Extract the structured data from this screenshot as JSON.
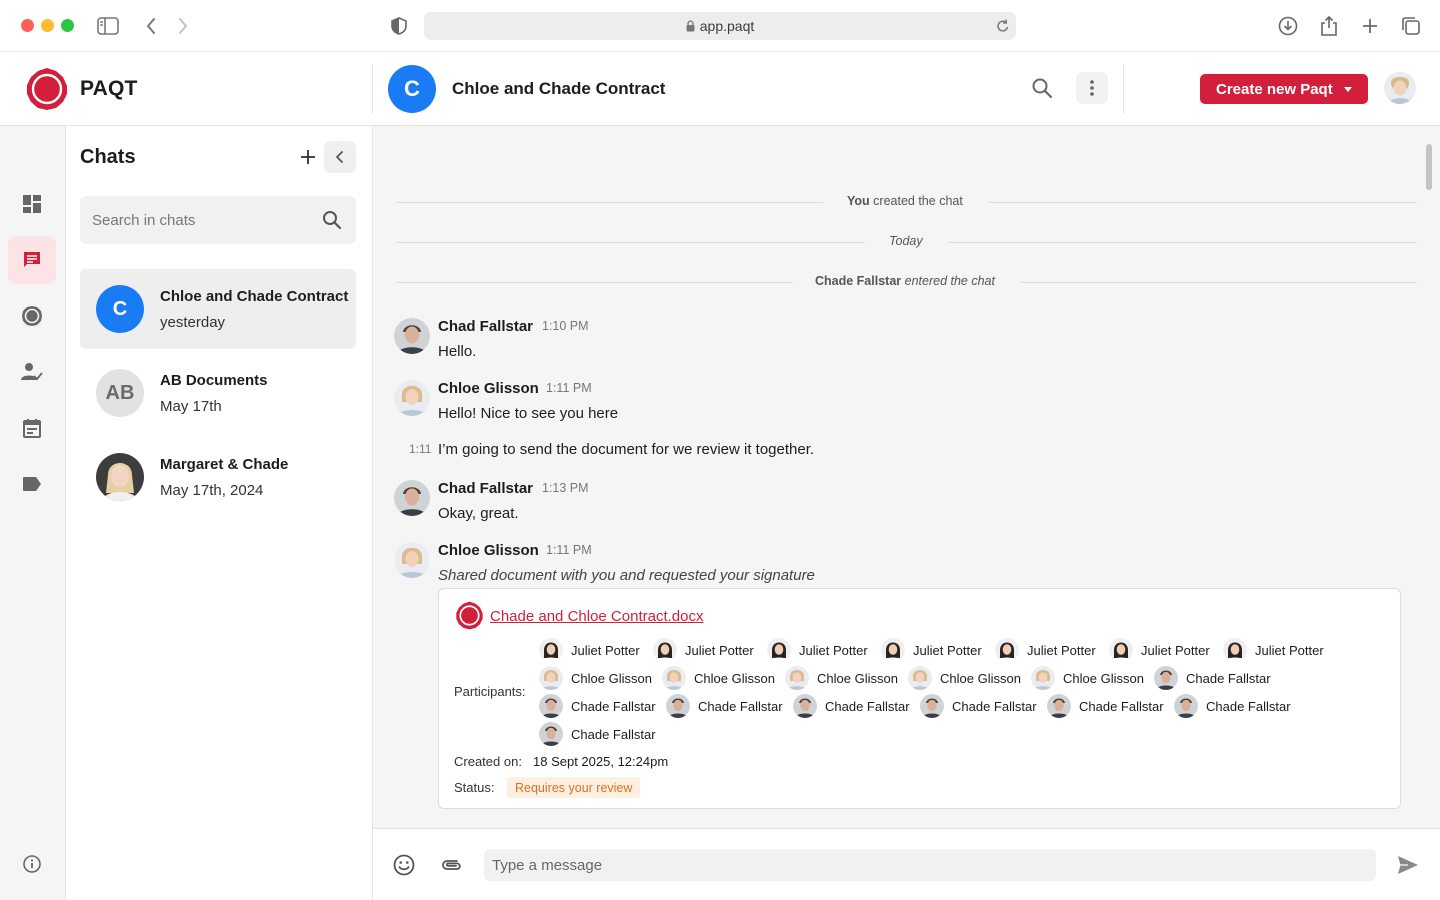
{
  "browser": {
    "url": "app.paqt"
  },
  "header": {
    "brand": "PAQT",
    "chat_avatar_letter": "C",
    "chat_title": "Chloe and Chade Contract",
    "create_button": "Create new Paqt"
  },
  "sidebar": {
    "title": "Chats",
    "search_placeholder": "Search in chats",
    "chats": [
      {
        "avatar": "C",
        "name": "Chloe and Chade Contract",
        "date": "yesterday"
      },
      {
        "avatar": "AB",
        "name": "AB Documents",
        "date": "May 17th"
      },
      {
        "avatar": "",
        "name": "Margaret & Chade",
        "date": "May 17th, 2024"
      }
    ]
  },
  "conversation": {
    "system1_bold": "You",
    "system1_rest": "created the chat",
    "day_divider": "Today",
    "system2_bold": "Chade Fallstar",
    "system2_rest": "entered the chat",
    "messages": [
      {
        "author": "Chad Fallstar",
        "time": "1:10 PM",
        "text": "Hello."
      },
      {
        "author": "Chloe Glisson",
        "time": "1:11 PM",
        "text": "Hello! Nice to see you here"
      },
      {
        "side_time": "1:11",
        "text": "I’m going to send the document for we review it together."
      },
      {
        "author": "Chad Fallstar",
        "time": "1:13 PM",
        "text": "Okay, great."
      },
      {
        "author": "Chloe Glisson",
        "time": "1:11 PM",
        "text": "Shared document with you and requested your signature"
      }
    ],
    "document": {
      "filename": "Chade and Chloe Contract.docx",
      "participants_label": "Participants:",
      "participants_row1": [
        "Juliet Potter",
        "Juliet Potter",
        "Juliet Potter",
        "Juliet Potter",
        "Juliet Potter",
        "Juliet Potter",
        "Juliet Potter"
      ],
      "participants_row2": [
        "Chloe Glisson",
        "Chloe Glisson",
        "Chloe Glisson",
        "Chloe Glisson",
        "Chloe Glisson",
        "Chade Fallstar"
      ],
      "participants_row3": [
        "Chade Fallstar",
        "Chade Fallstar",
        "Chade Fallstar",
        "Chade Fallstar",
        "Chade Fallstar",
        "Chade Fallstar"
      ],
      "participants_row4": [
        "Chade Fallstar"
      ],
      "created_label": "Created on:",
      "created_value": "18 Sept 2025, 12:24pm",
      "status_label": "Status:",
      "status_value": "Requires your review"
    }
  },
  "composer": {
    "placeholder": "Type a message"
  },
  "colors": {
    "brand_red": "#d21f3c",
    "chat_blue": "#1a7cf5",
    "status_orange": "#e0701d"
  }
}
